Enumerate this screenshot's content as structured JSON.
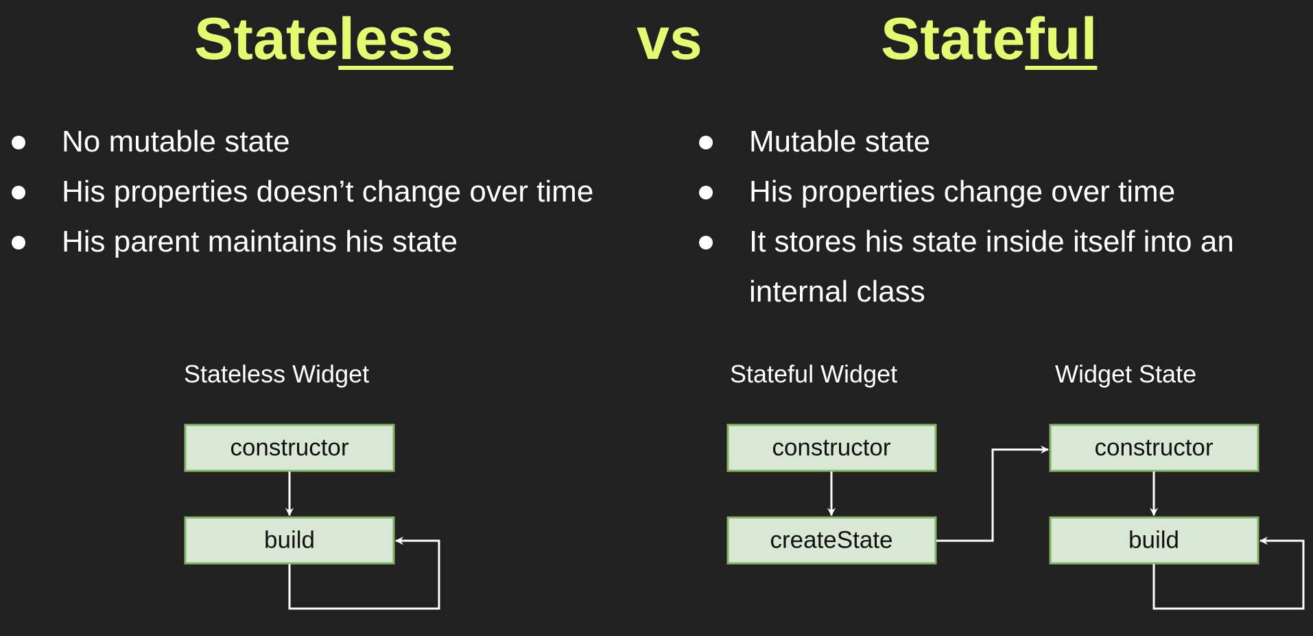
{
  "title": {
    "left_prefix": "State",
    "left_underlined": "less",
    "vs": "vs",
    "right_prefix": "State",
    "right_underlined": "ful"
  },
  "accent_color": "#e3fb70",
  "stateless_points": [
    "No mutable state",
    "His properties doesn’t change over time",
    "His parent maintains his state"
  ],
  "stateful_points": [
    "Mutable state",
    "His properties change over time",
    "It stores his state inside itself into an internal class"
  ],
  "diagrams": {
    "stateless_label": "Stateless Widget",
    "stateful_label": "Stateful Widget",
    "state_label": "Widget State",
    "stateless_boxes": [
      "constructor",
      "build"
    ],
    "stateful_boxes": [
      "constructor",
      "createState"
    ],
    "state_boxes": [
      "constructor",
      "build"
    ],
    "box_fill": "#d9e8d5",
    "box_border": "#82b366"
  }
}
